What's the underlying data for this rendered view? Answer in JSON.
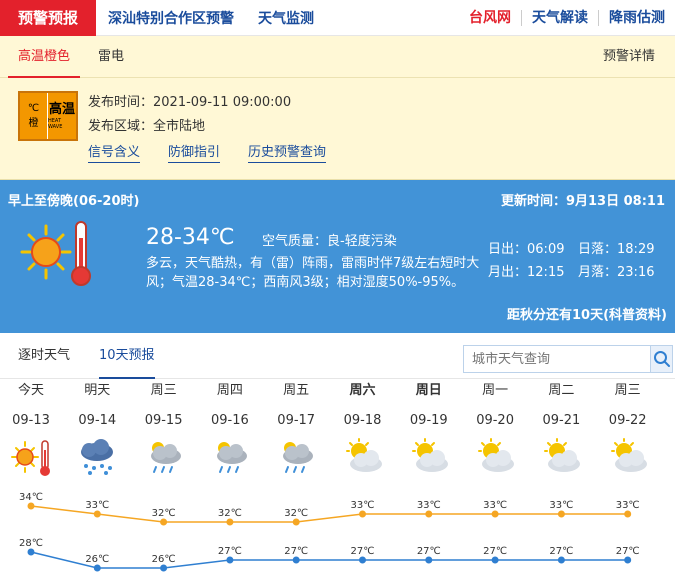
{
  "topnav": {
    "active_tab": "预警预报",
    "links": [
      "深汕特别合作区预警",
      "天气监测"
    ],
    "right_links": [
      "台风网",
      "天气解读",
      "降雨估测"
    ]
  },
  "warning": {
    "tabs": [
      "高温橙色",
      "雷电"
    ],
    "detail_link": "预警详情",
    "signal": {
      "title": "高温",
      "subtitle": "HEAT WAVE",
      "level": "橙",
      "unit": "℃",
      "color": "#f39700"
    },
    "publish_time_label": "发布时间：",
    "publish_time": "2021-09-11 09:00:00",
    "area_label": "发布区域：",
    "area": "全市陆地",
    "links": [
      "信号含义",
      "防御指引",
      "历史预警查询"
    ]
  },
  "today": {
    "period": "早上至傍晚(06-20时)",
    "update_label": "更新时间：",
    "update_time": "9月13日 08:11",
    "temp": "28-34℃",
    "aq_label": "空气质量：",
    "aq": "良-轻度污染",
    "desc": "多云，天气酷热，有（雷）阵雨，雷雨时伴7级左右短时大风；气温28-34℃；西南风3级；相对湿度50%-95%。",
    "sunrise_label": "日出：",
    "sunrise": "06:09",
    "sunset_label": "日落：",
    "sunset": "18:29",
    "moonrise_label": "月出：",
    "moonrise": "12:15",
    "moonset_label": "月落：",
    "moonset": "23:16",
    "jieqi": "距秋分还有10天(科普资料)"
  },
  "forecast": {
    "tabs": [
      "逐时天气",
      "10天预报"
    ],
    "search_placeholder": "城市天气查询",
    "days": [
      {
        "week": "今天",
        "date": "09-13",
        "icon": "sun-hot-icon",
        "high": 34,
        "low": 28,
        "bold": false
      },
      {
        "week": "明天",
        "date": "09-14",
        "icon": "thunderstorm-icon",
        "high": 33,
        "low": 26,
        "bold": false
      },
      {
        "week": "周三",
        "date": "09-15",
        "icon": "cloud-rain-icon",
        "high": 32,
        "low": 26,
        "bold": false
      },
      {
        "week": "周四",
        "date": "09-16",
        "icon": "cloud-rain-icon",
        "high": 32,
        "low": 27,
        "bold": false
      },
      {
        "week": "周五",
        "date": "09-17",
        "icon": "cloud-rain-icon",
        "high": 32,
        "low": 27,
        "bold": false
      },
      {
        "week": "周六",
        "date": "09-18",
        "icon": "partly-cloudy-icon",
        "high": 33,
        "low": 27,
        "bold": true
      },
      {
        "week": "周日",
        "date": "09-19",
        "icon": "partly-cloudy-icon",
        "high": 33,
        "low": 27,
        "bold": true
      },
      {
        "week": "周一",
        "date": "09-20",
        "icon": "partly-cloudy-icon",
        "high": 33,
        "low": 27,
        "bold": false
      },
      {
        "week": "周二",
        "date": "09-21",
        "icon": "partly-cloudy-icon",
        "high": 33,
        "low": 27,
        "bold": false
      },
      {
        "week": "周三",
        "date": "09-22",
        "icon": "partly-cloudy-icon",
        "high": 33,
        "low": 27,
        "bold": false
      }
    ],
    "high_color": "#f5a623",
    "low_color": "#2f7fd1",
    "temp_unit": "℃"
  }
}
